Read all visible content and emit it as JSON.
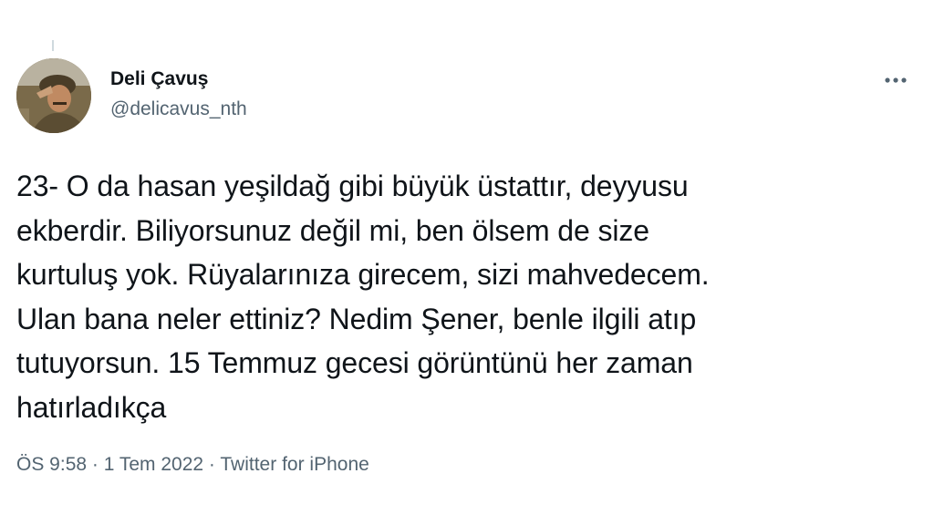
{
  "author": {
    "display_name": "Deli Çavuş",
    "handle": "@delicavus_nth",
    "avatar_icon": "profile-photo"
  },
  "menu": {
    "icon": "more-horizontal-icon"
  },
  "tweet": {
    "text": "23- O da hasan yeşildağ gibi büyük üstattır, deyyusu\nekberdir. Biliyorsunuz değil mi, ben ölsem de size\nkurtuluş yok. Rüyalarınıza girecem, sizi mahvedecem.\nUlan bana neler ettiniz? Nedim Şener, benle ilgili atıp\ntutuyorsun. 15 Temmuz gecesi görüntünü her zaman\nhatırladıkça"
  },
  "meta": {
    "time": "ÖS 9:58",
    "separator": " · ",
    "date": "1 Tem 2022",
    "source": "Twitter for iPhone"
  },
  "colors": {
    "text_primary": "#0f1419",
    "text_secondary": "#536471",
    "background": "#ffffff"
  }
}
